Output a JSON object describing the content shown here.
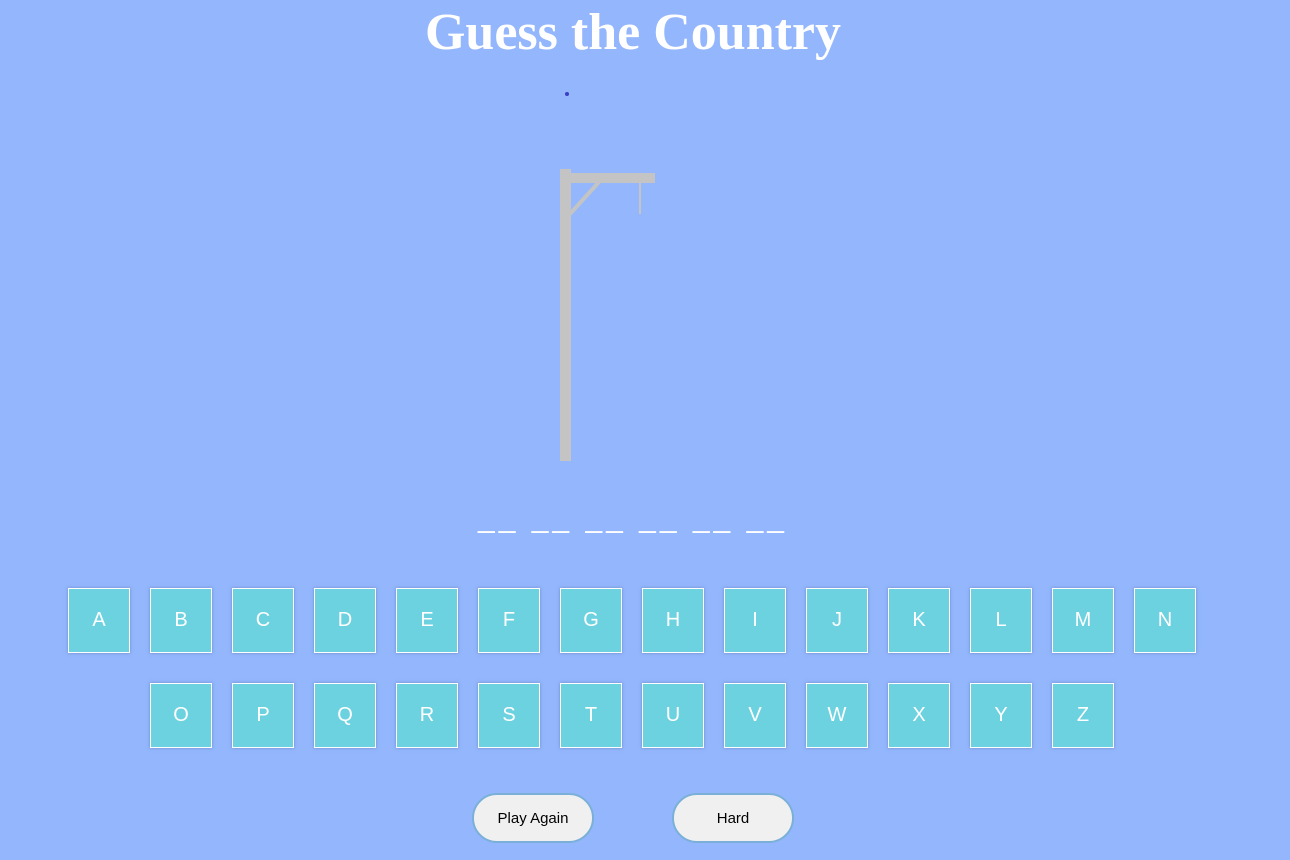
{
  "header": {
    "title": "Guess the Country"
  },
  "word": {
    "blanks": "__ __ __ __ __ __"
  },
  "keyboard": {
    "row1": [
      "A",
      "B",
      "C",
      "D",
      "E",
      "F",
      "G",
      "H",
      "I",
      "J",
      "K",
      "L",
      "M",
      "N"
    ],
    "row2": [
      "O",
      "P",
      "Q",
      "R",
      "S",
      "T",
      "U",
      "V",
      "W",
      "X",
      "Y",
      "Z"
    ]
  },
  "controls": {
    "play_again_label": "Play Again",
    "difficulty_label": "Hard"
  },
  "colors": {
    "background": "#93b6fc",
    "key_fill": "#6dd2e0",
    "gallows": "#c4c4c4",
    "text": "#ffffff"
  }
}
